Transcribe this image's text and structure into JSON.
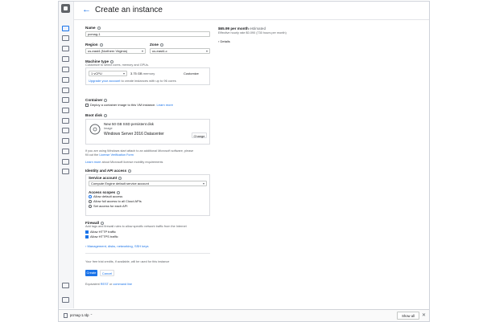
{
  "header": {
    "back_icon": "←",
    "title": "Create an instance"
  },
  "form": {
    "name_label": "Name",
    "name_value": "pcmag-1",
    "region_label": "Region",
    "region_value": "us-east4 (Northern Virginia)",
    "zone_label": "Zone",
    "zone_value": "us-east4-c",
    "machine_label": "Machine type",
    "machine_sub": "Customize to select cores, memory and GPUs.",
    "vcpu_value": "1 vCPU",
    "memory_value": "3.75 GB",
    "memory_unit": "memory",
    "customize_link": "Customize",
    "upgrade_link": "Upgrade your account",
    "upgrade_rest": "to create instances with up to 96 cores",
    "container_label": "Container",
    "container_check": "Deploy a container image to this VM instance.",
    "container_learn": "Learn more",
    "boot_label": "Boot disk",
    "boot_title": "New 50 GB SSD persistent disk",
    "boot_image_label": "Image",
    "boot_image": "Windows Server 2016 Datacenter",
    "boot_change": "Change",
    "win_note_1": "If you are using Windows start attach to an additional Microsoft software, please",
    "win_note_2": "fill out the",
    "win_note_link": "License Verification Form",
    "learn_more_link": "Learn more",
    "learn_more_rest": "about Microsoft license mobility requirements",
    "identity_label": "Identity and API access",
    "service_account_label": "Service account",
    "service_account_value": "Compute Engine default service account",
    "access_scopes_label": "Access scopes",
    "scope_1": "Allow default access",
    "scope_2": "Allow full access to all Cloud APIs",
    "scope_3": "Set access for each API",
    "firewall_label": "Firewall",
    "firewall_sub": "Add tags and firewall rules to allow specific network traffic from the Internet",
    "http_label": "Allow HTTP traffic",
    "https_label": "Allow HTTPS traffic",
    "mgmt_link": "Management, disks, networking, SSH keys",
    "free_trial": "Your free trial credits, if available, will be used for this instance",
    "create_button": "Create",
    "cancel_button": "Cancel",
    "equiv_prefix": "Equivalent",
    "rest_link": "REST",
    "or_text": "or",
    "cmdline_link": "command line"
  },
  "pricing": {
    "monthly": "$65.99 per month",
    "estimated": "estimated",
    "hourly": "Effective hourly rate $0.090 (730 hours per month)",
    "details": "Details"
  },
  "downloads": {
    "file_name": "pcmag-1.rdp",
    "show_all": "Show all",
    "close_icon": "✕"
  },
  "colors": {
    "accent": "#1a73e8",
    "text": "#202124",
    "muted": "#5f6368"
  }
}
